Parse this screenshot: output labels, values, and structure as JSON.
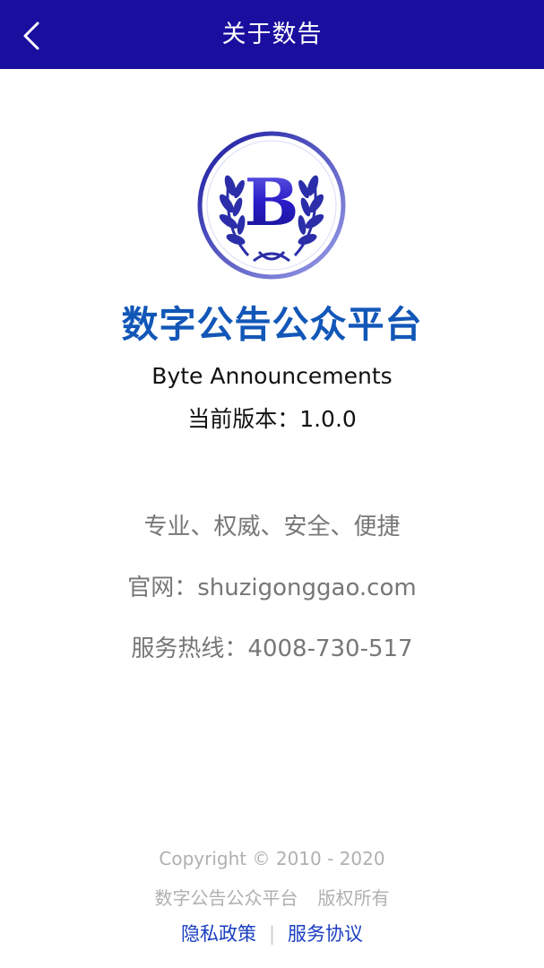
{
  "header": {
    "title": "关于数告",
    "back_icon": "chevron-left-icon",
    "background": "#1a0e9e"
  },
  "logo": {
    "icon": "laurel-b-logo",
    "letter": "B"
  },
  "app": {
    "name": "数字公告公众平台",
    "english_name": "Byte Announcements",
    "version_text": "当前版本：1.0.0",
    "name_color": "#1257b8"
  },
  "info": {
    "slogan": "专业、权威、安全、便捷",
    "website": "官网：shuzigonggao.com",
    "hotline": "服务热线：4008-730-517"
  },
  "footer": {
    "copyright": "Copyright © 2010 - 2020",
    "company": "数字公告公众平台",
    "rights": "版权所有",
    "privacy_label": "隐私政策",
    "separator": "|",
    "service_label": "服务协议",
    "link_color": "#1a3ec0"
  }
}
